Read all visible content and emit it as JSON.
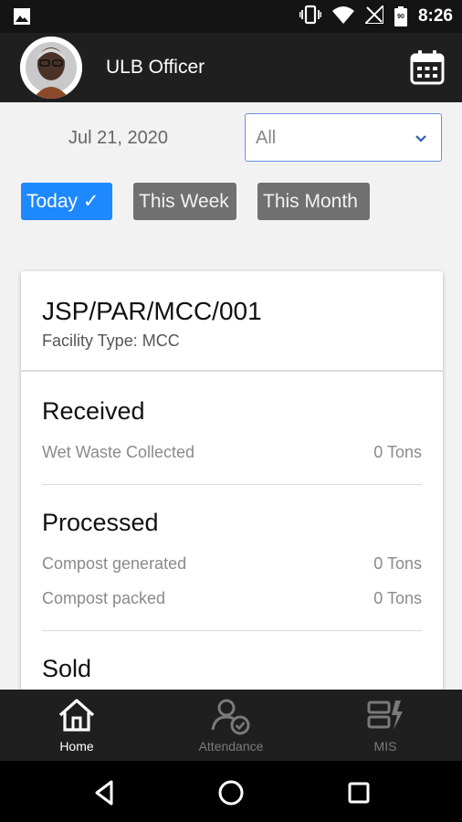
{
  "status_bar": {
    "time": "8:26",
    "battery_level": "90",
    "icons": [
      "image-icon",
      "vibrate-icon",
      "wifi-icon",
      "no-signal-icon",
      "battery-icon"
    ]
  },
  "app_bar": {
    "title": "ULB Officer",
    "avatar_icon": "user-avatar",
    "action_icon": "calendar-icon"
  },
  "filters": {
    "date": "Jul 21, 2020",
    "select_value": "All",
    "chips": [
      {
        "label": "Today ✓",
        "active": true
      },
      {
        "label": "This Week",
        "active": false
      },
      {
        "label": "This Month",
        "active": false
      }
    ]
  },
  "facility": {
    "code": "JSP/PAR/MCC/001",
    "type": "Facility Type: MCC",
    "sections": {
      "received": {
        "title": "Received",
        "rows": [
          {
            "label": "Wet Waste Collected",
            "value": "0 Tons"
          }
        ]
      },
      "processed": {
        "title": "Processed",
        "rows": [
          {
            "label": "Compost generated",
            "value": "0 Tons"
          },
          {
            "label": "Compost packed",
            "value": "0 Tons"
          }
        ]
      },
      "sold": {
        "title": "Sold"
      }
    }
  },
  "bottom_nav": {
    "items": [
      {
        "label": "Home",
        "icon": "home-icon",
        "active": true
      },
      {
        "label": "Attendance",
        "icon": "attendance-icon",
        "active": false
      },
      {
        "label": "MIS",
        "icon": "mis-icon",
        "active": false
      }
    ]
  },
  "colors": {
    "accent": "#1e88ff",
    "chip_inactive": "#707070",
    "nav_active": "#ffffff",
    "nav_inactive": "#7a7a7a"
  }
}
